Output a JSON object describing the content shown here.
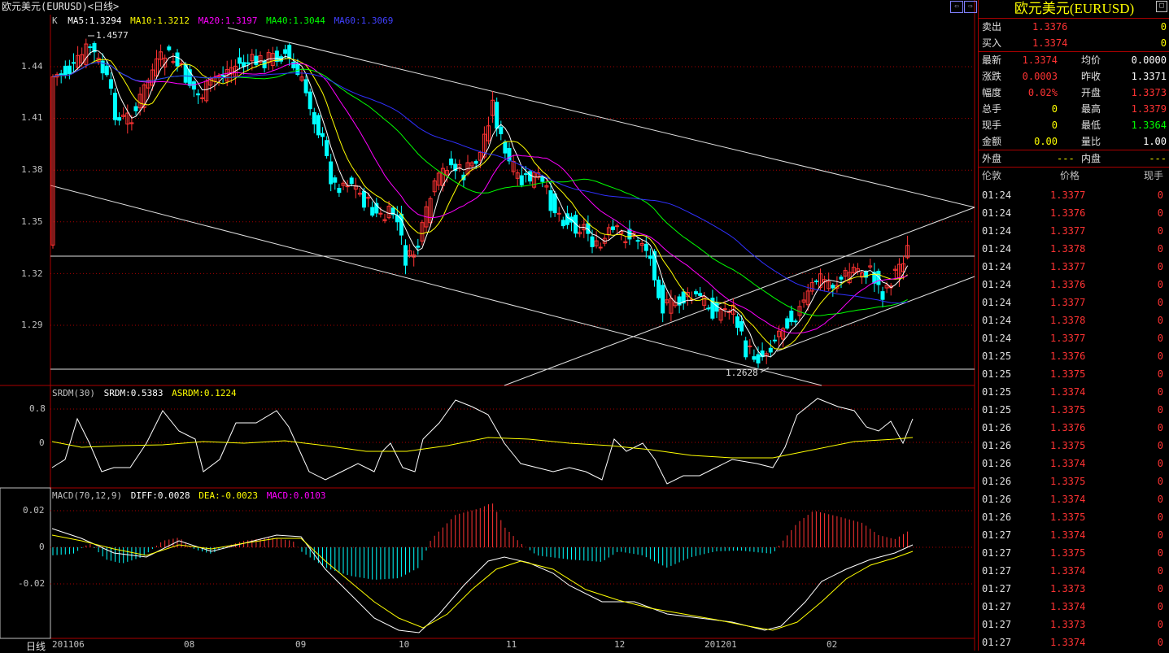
{
  "window": {
    "title": "欧元美元(EURUSD)<日线>"
  },
  "main_panel": {
    "legend": {
      "k": "K",
      "ma5": "MA5:1.3294",
      "ma10": "MA10:1.3212",
      "ma20": "MA20:1.3197",
      "ma40": "MA40:1.3044",
      "ma60": "MA60:1.3069"
    },
    "y_ticks": [
      "1.44",
      "1.41",
      "1.38",
      "1.35",
      "1.32",
      "1.29"
    ],
    "high_label": "1.4577",
    "low_label": "1.2628",
    "colors": {
      "ma5": "#ffffff",
      "ma10": "#ffff00",
      "ma20": "#ff00ff",
      "ma40": "#00ff00",
      "ma60": "#0000ff",
      "up": "#ff3333",
      "down": "#00ffff"
    }
  },
  "srdm_panel": {
    "legend": {
      "name": "SRDM(30)",
      "srdm": "SRDM:0.5383",
      "asrdm": "ASRDM:0.1224"
    },
    "y_ticks": [
      "0.8",
      "0"
    ]
  },
  "macd_panel": {
    "legend": {
      "name": "MACD(70,12,9)",
      "diff": "DIFF:0.0028",
      "dea": "DEA:-0.0023",
      "macd": "MACD:0.0103"
    },
    "y_ticks": [
      "0.02",
      "0",
      "-0.02"
    ]
  },
  "x_axis": {
    "period": "日线",
    "labels": [
      "201106",
      "08",
      "09",
      "10",
      "11",
      "12",
      "201201",
      "02"
    ]
  },
  "chart_data": {
    "type": "candlestick",
    "title": "欧元美元(EURUSD)<日线>",
    "x_labels": [
      "201106",
      "08",
      "09",
      "10",
      "11",
      "12",
      "201201",
      "02"
    ],
    "y_range": [
      1.26,
      1.46
    ],
    "marked_high": 1.4577,
    "marked_low": 1.2628,
    "ma_values": {
      "MA5": 1.3294,
      "MA10": 1.3212,
      "MA20": 1.3197,
      "MA40": 1.3044,
      "MA60": 1.3069
    },
    "indicators": [
      {
        "name": "SRDM(30)",
        "SRDM": 0.5383,
        "ASRDM": 0.1224
      },
      {
        "name": "MACD(70,12,9)",
        "DIFF": 0.0028,
        "DEA": -0.0023,
        "MACD": 0.0103
      }
    ]
  },
  "quote_panel": {
    "title": "欧元美元(EURUSD)",
    "rows": [
      {
        "label": "卖出",
        "value": "1.3376",
        "value_color": "red",
        "extra": "0",
        "extra_color": "yel"
      },
      {
        "label": "买入",
        "value": "1.3374",
        "value_color": "red",
        "extra": "0",
        "extra_color": "yel"
      }
    ],
    "stats": [
      {
        "l1": "最新",
        "v1": "1.3374",
        "c1": "red",
        "l2": "均价",
        "v2": "0.0000",
        "c2": "wht"
      },
      {
        "l1": "涨跌",
        "v1": "0.0003",
        "c1": "red",
        "l2": "昨收",
        "v2": "1.3371",
        "c2": "wht"
      },
      {
        "l1": "幅度",
        "v1": "0.02%",
        "c1": "red",
        "l2": "开盘",
        "v2": "1.3373",
        "c2": "red"
      },
      {
        "l1": "总手",
        "v1": "0",
        "c1": "yel",
        "l2": "最高",
        "v2": "1.3379",
        "c2": "red"
      },
      {
        "l1": "现手",
        "v1": "0",
        "c1": "yel",
        "l2": "最低",
        "v2": "1.3364",
        "c2": "grn"
      },
      {
        "l1": "金额",
        "v1": "0.00",
        "c1": "yel",
        "l2": "量比",
        "v2": "1.00",
        "c2": "wht"
      }
    ],
    "outer": {
      "label": "外盘",
      "value": "---",
      "inner_label": "内盘",
      "inner_value": "---"
    },
    "ticks_header": {
      "time": "伦敦",
      "price": "价格",
      "vol": "现手"
    },
    "ticks": [
      {
        "time": "01:24",
        "price": "1.3377",
        "vol": "0"
      },
      {
        "time": "01:24",
        "price": "1.3376",
        "vol": "0"
      },
      {
        "time": "01:24",
        "price": "1.3377",
        "vol": "0"
      },
      {
        "time": "01:24",
        "price": "1.3378",
        "vol": "0"
      },
      {
        "time": "01:24",
        "price": "1.3377",
        "vol": "0"
      },
      {
        "time": "01:24",
        "price": "1.3376",
        "vol": "0"
      },
      {
        "time": "01:24",
        "price": "1.3377",
        "vol": "0"
      },
      {
        "time": "01:24",
        "price": "1.3378",
        "vol": "0"
      },
      {
        "time": "01:24",
        "price": "1.3377",
        "vol": "0"
      },
      {
        "time": "01:25",
        "price": "1.3376",
        "vol": "0"
      },
      {
        "time": "01:25",
        "price": "1.3375",
        "vol": "0"
      },
      {
        "time": "01:25",
        "price": "1.3374",
        "vol": "0"
      },
      {
        "time": "01:25",
        "price": "1.3375",
        "vol": "0"
      },
      {
        "time": "01:26",
        "price": "1.3376",
        "vol": "0"
      },
      {
        "time": "01:26",
        "price": "1.3375",
        "vol": "0"
      },
      {
        "time": "01:26",
        "price": "1.3374",
        "vol": "0"
      },
      {
        "time": "01:26",
        "price": "1.3375",
        "vol": "0"
      },
      {
        "time": "01:26",
        "price": "1.3374",
        "vol": "0"
      },
      {
        "time": "01:26",
        "price": "1.3375",
        "vol": "0"
      },
      {
        "time": "01:27",
        "price": "1.3374",
        "vol": "0"
      },
      {
        "time": "01:27",
        "price": "1.3375",
        "vol": "0"
      },
      {
        "time": "01:27",
        "price": "1.3374",
        "vol": "0"
      },
      {
        "time": "01:27",
        "price": "1.3373",
        "vol": "0"
      },
      {
        "time": "01:27",
        "price": "1.3374",
        "vol": "0"
      },
      {
        "time": "01:27",
        "price": "1.3373",
        "vol": "0"
      },
      {
        "time": "01:27",
        "price": "1.3374",
        "vol": "0"
      }
    ]
  }
}
